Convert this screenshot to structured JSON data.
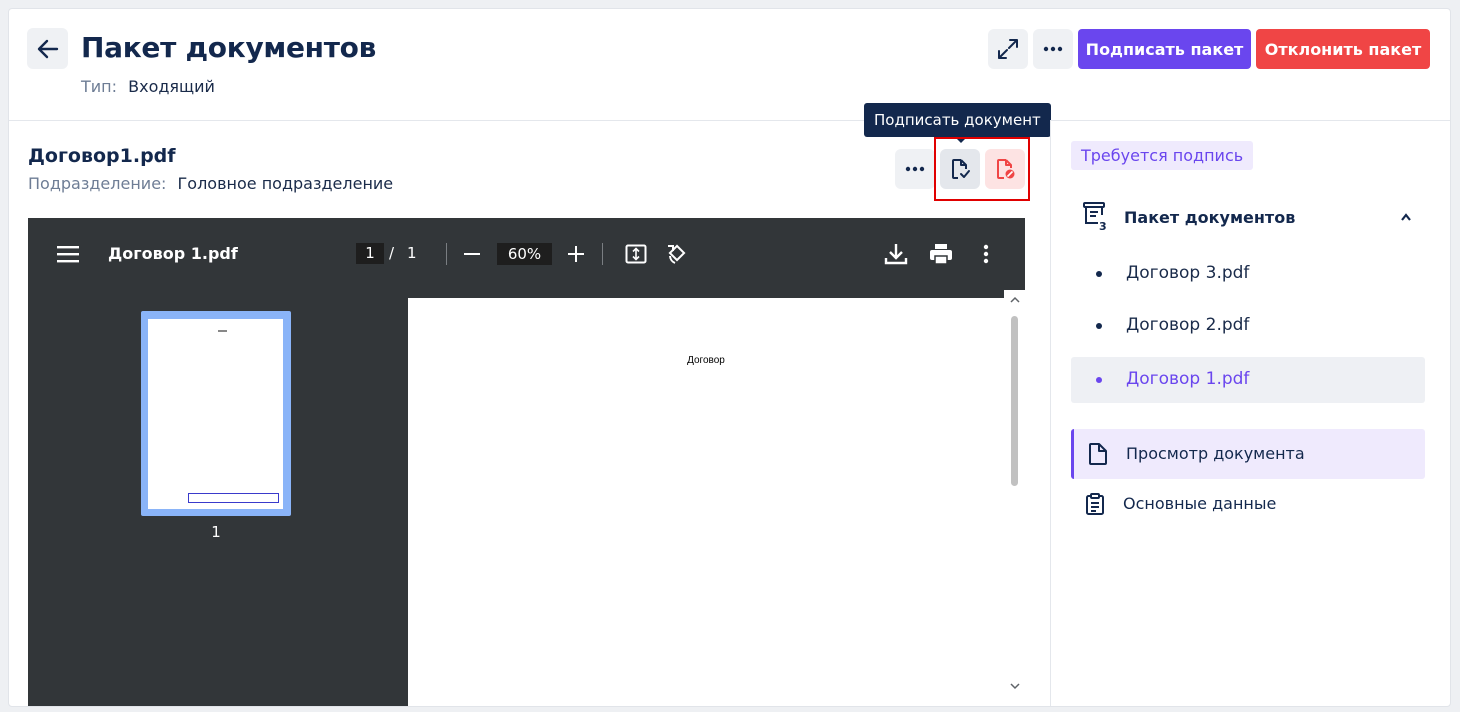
{
  "header": {
    "title": "Пакет документов",
    "type_label": "Тип:",
    "type_value": "Входящий",
    "sign_package_label": "Подписать пакет",
    "reject_package_label": "Отклонить пакет"
  },
  "document": {
    "name": "Договор1.pdf",
    "department_label": "Подразделение:",
    "department_value": "Головное подразделение",
    "tooltip": "Подписать документ"
  },
  "viewer": {
    "file_title": "Договор 1.pdf",
    "current_page": "1",
    "page_separator": "/",
    "total_pages": "1",
    "zoom": "60%",
    "thumbnail_label": "1",
    "page_heading": "Договор"
  },
  "sidebar": {
    "status_badge": "Требуется подпись",
    "package_title": "Пакет документов",
    "package_count": "3",
    "documents": [
      {
        "label": "Договор 3.pdf",
        "active": false
      },
      {
        "label": "Договор 2.pdf",
        "active": false
      },
      {
        "label": "Договор 1.pdf",
        "active": true
      }
    ],
    "nav": [
      {
        "label": "Просмотр документа",
        "icon": "file-icon",
        "active": true
      },
      {
        "label": "Основные данные",
        "icon": "clipboard-icon",
        "active": false
      }
    ]
  },
  "colors": {
    "accent": "#6a46ee",
    "danger": "#f04545",
    "title": "#13284d",
    "viewer_bg": "#323639"
  }
}
